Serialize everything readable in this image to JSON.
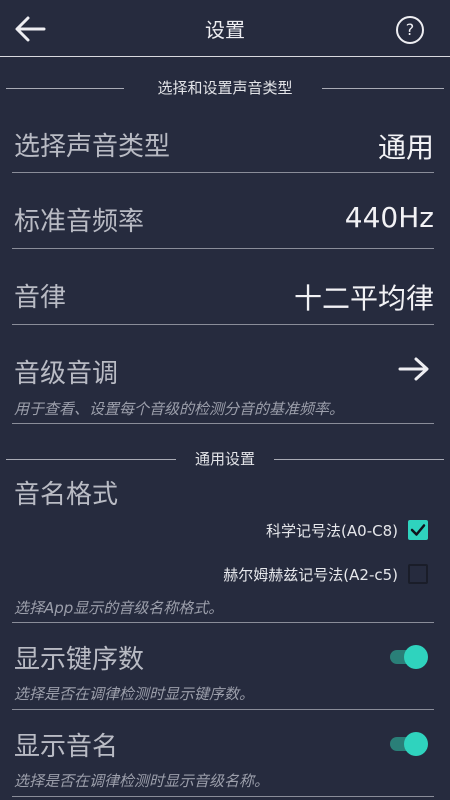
{
  "header": {
    "title": "设置",
    "help_label": "?"
  },
  "section1": {
    "title": "选择和设置声音类型"
  },
  "sound_type": {
    "label": "选择声音类型",
    "value": "通用"
  },
  "standard_freq": {
    "label": "标准音频率",
    "value": "440Hz"
  },
  "temperament": {
    "label": "音律",
    "value": "十二平均律"
  },
  "pitch_tuning": {
    "label": "音级音调",
    "description": "用于查看、设置每个音级的检测分音的基准频率。"
  },
  "section2": {
    "title": "通用设置"
  },
  "note_name_format": {
    "label": "音名格式",
    "options": [
      {
        "label": "科学记号法(A0-C8)",
        "checked": true
      },
      {
        "label": "赫尔姆赫兹记号法(A2-c5)",
        "checked": false
      }
    ],
    "description": "选择App显示的音级名称格式。"
  },
  "show_key_number": {
    "label": "显示键序数",
    "description": "选择是否在调律检测时显示键序数。",
    "enabled": true
  },
  "show_note_name": {
    "label": "显示音名",
    "description": "选择是否在调律检测时显示音级名称。",
    "enabled": true
  },
  "colors": {
    "accent": "#2fd3be",
    "background": "#262b3e"
  }
}
